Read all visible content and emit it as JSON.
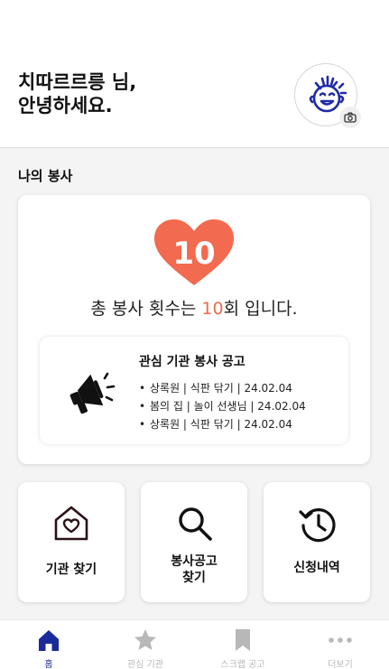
{
  "header": {
    "greeting_line1": "치따르르릉 님,",
    "greeting_line2": "안녕하세요."
  },
  "volunteer": {
    "section_title": "나의 봉사",
    "count": "10",
    "total_prefix": "총 봉사 횟수는 ",
    "total_count": "10",
    "total_suffix": "회 입니다."
  },
  "notice": {
    "title": "관심 기관 봉사 공고",
    "items": [
      "상록원 | 식판 닦기 | 24.02.04",
      "봄의 집 | 놀이 선생님 | 24.02.04",
      "상록원 | 식판 닦기 | 24.02.04"
    ]
  },
  "menu": {
    "find_org": "기관 찾기",
    "find_notice_line1": "봉사공고",
    "find_notice_line2": "찾기",
    "history": "신청내역"
  },
  "tabs": [
    {
      "label": "홈",
      "icon": "home-icon",
      "active": true
    },
    {
      "label": "관심 기관",
      "icon": "star-icon",
      "active": false
    },
    {
      "label": "스크랩 공고",
      "icon": "bookmark-icon",
      "active": false
    },
    {
      "label": "더보기",
      "icon": "more-icon",
      "active": false
    }
  ],
  "colors": {
    "accent": "#f26a4f",
    "active_tab": "#1b2a9a",
    "inactive_tab": "#b8b8b8",
    "avatar_stroke": "#1f2aa8"
  }
}
